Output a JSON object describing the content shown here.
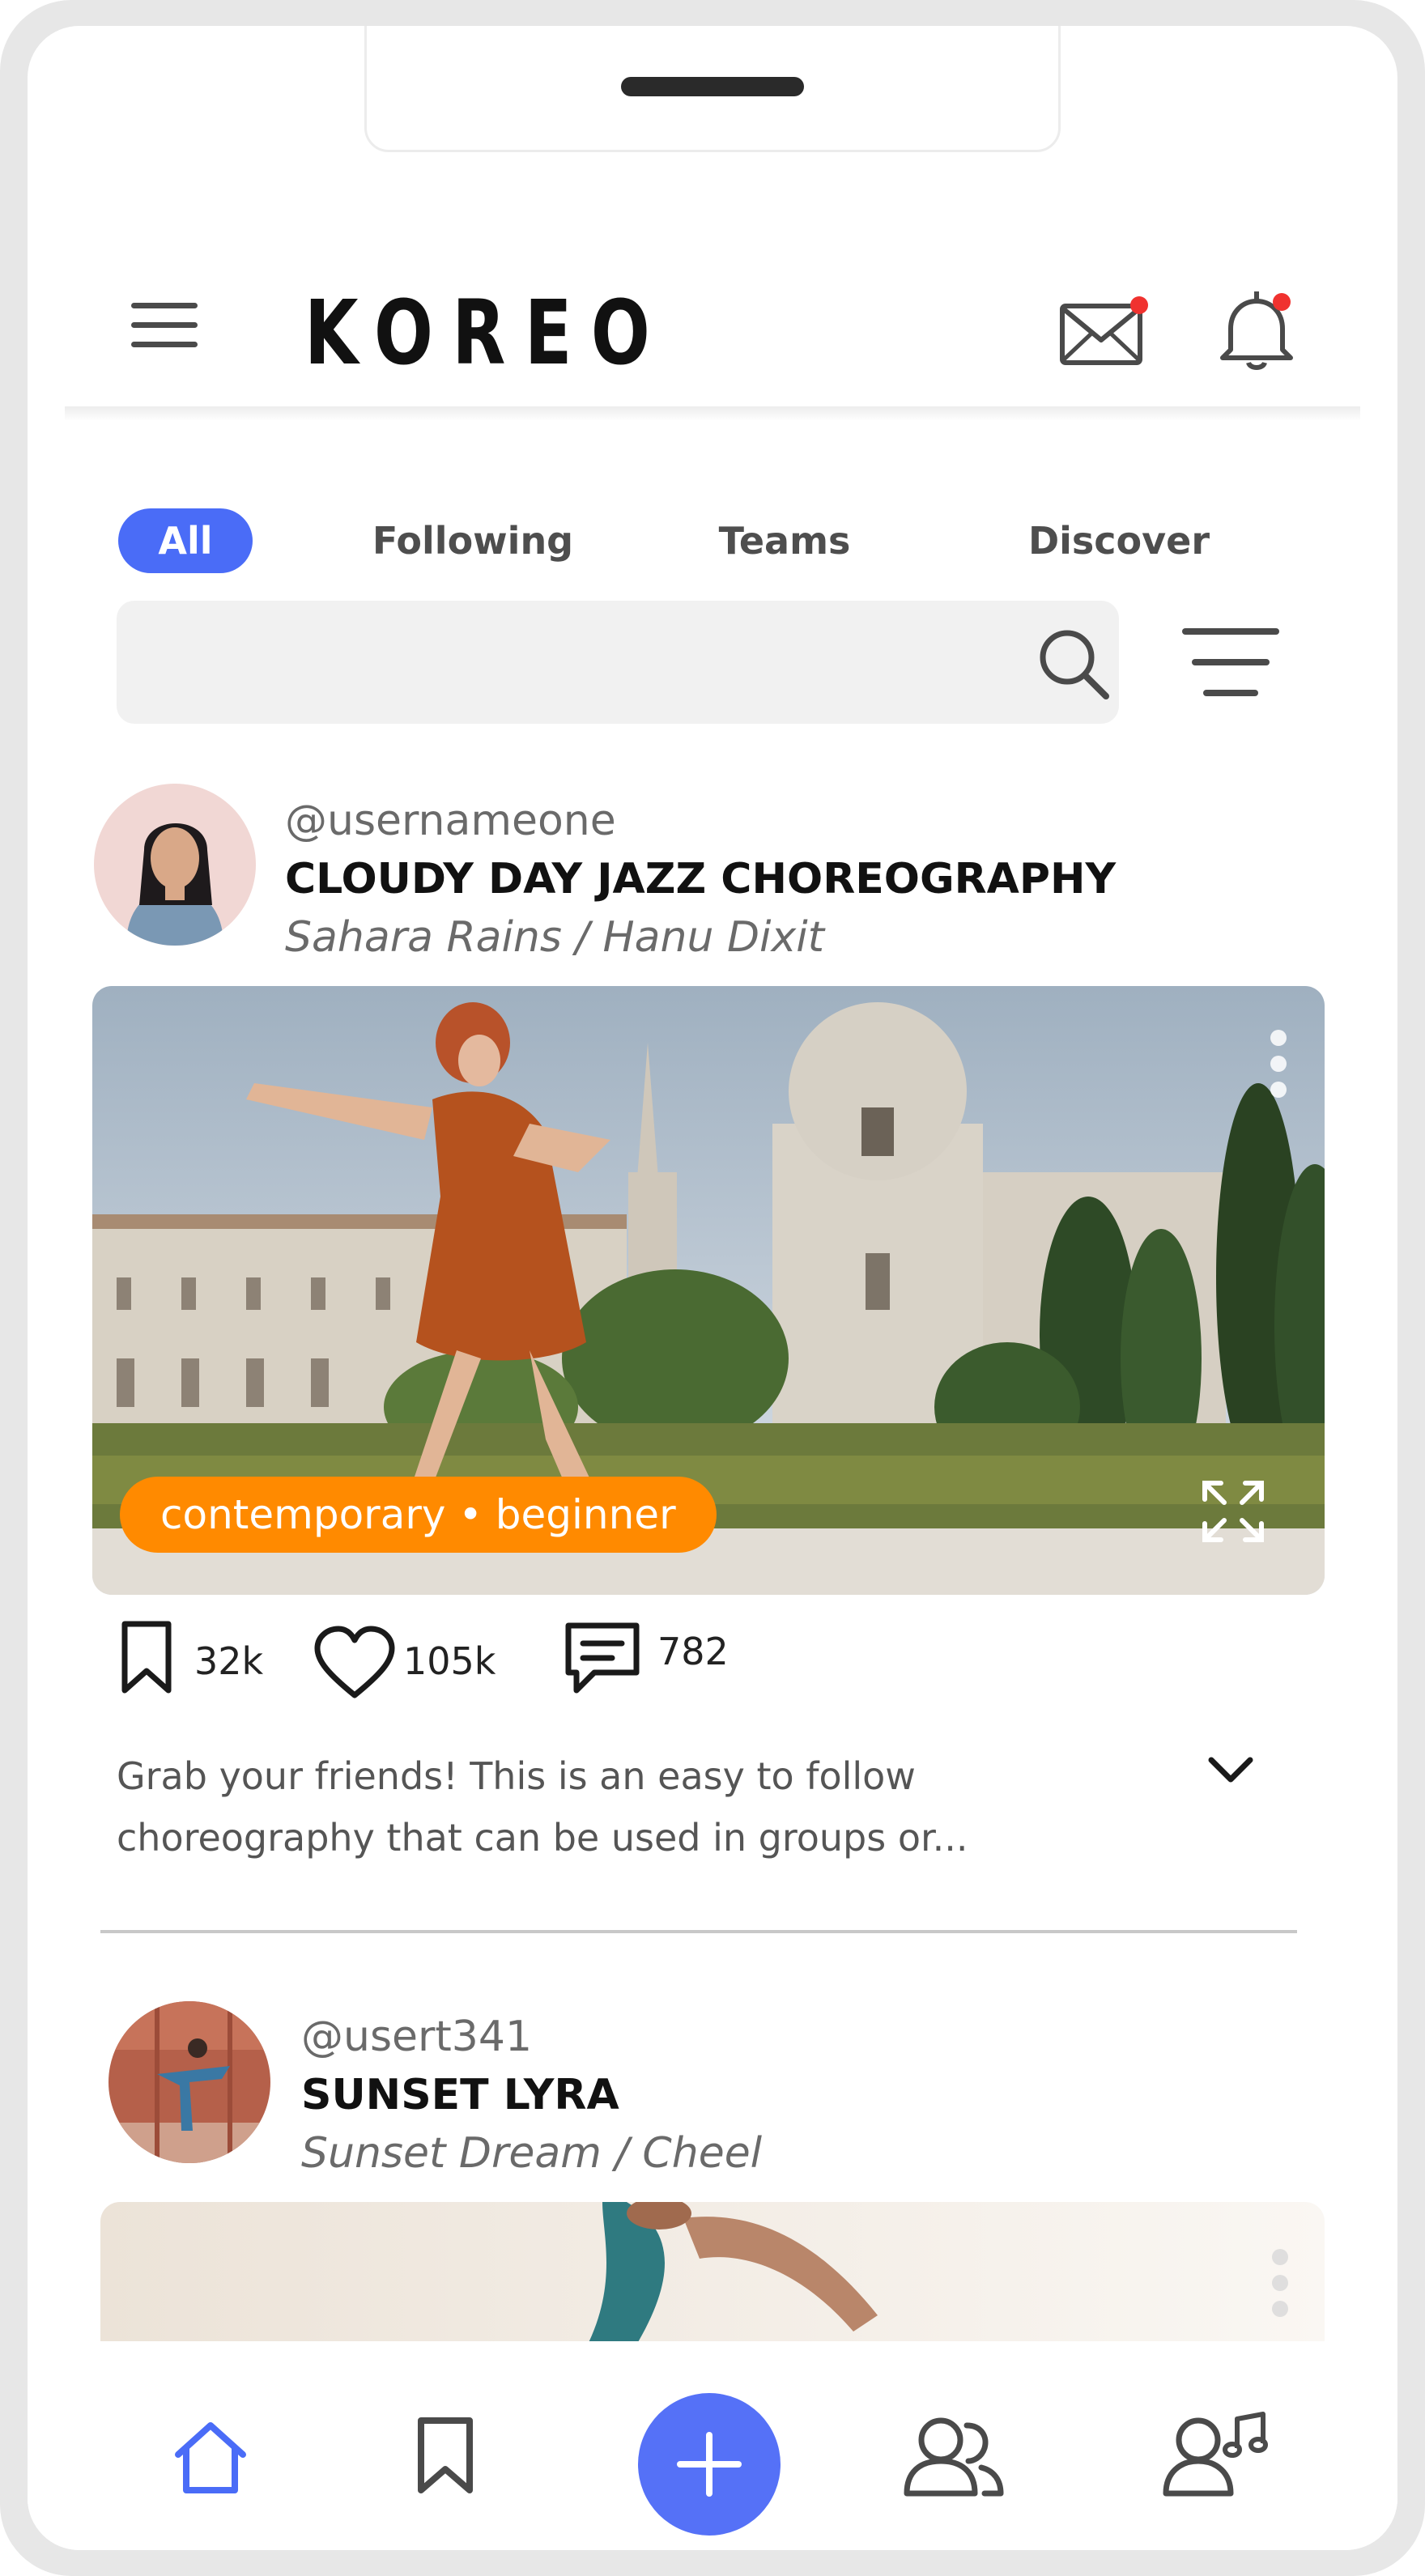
{
  "app": {
    "logo": "KOREO"
  },
  "header": {
    "menu_icon": "hamburger-menu-icon",
    "mail_icon": "envelope-icon",
    "bell_icon": "bell-icon",
    "badge_color": "#f0322f"
  },
  "tabs": [
    {
      "label": "All",
      "active": true
    },
    {
      "label": "Following",
      "active": false
    },
    {
      "label": "Teams",
      "active": false
    },
    {
      "label": "Discover",
      "active": false
    }
  ],
  "search": {
    "placeholder": "",
    "icon": "search-icon",
    "filter_icon": "filter-lines-icon"
  },
  "posts": [
    {
      "username": "@usernameone",
      "title": "CLOUDY DAY JAZZ CHOREOGRAPHY",
      "credits": "Sahara Rains / Hanu Dixit",
      "tag": "contemporary • beginner",
      "stats": {
        "saves": "32k",
        "likes": "105k",
        "comments": "782"
      },
      "description": "Grab your friends! This is an easy to follow choreography that can be used in groups or..."
    },
    {
      "username": "@usert341",
      "title": "SUNSET LYRA",
      "credits": "Sunset Dream / Cheel"
    }
  ],
  "bottom_nav": [
    {
      "name": "home",
      "icon": "home-icon",
      "active": true
    },
    {
      "name": "saved",
      "icon": "bookmark-icon",
      "active": false
    },
    {
      "name": "create",
      "icon": "plus-icon",
      "active": false
    },
    {
      "name": "teams",
      "icon": "people-icon",
      "active": false
    },
    {
      "name": "profile",
      "icon": "user-music-icon",
      "active": false
    }
  ],
  "colors": {
    "accent": "#4a6cf7",
    "tag": "#ff8a00",
    "fab": "#5571f7"
  }
}
